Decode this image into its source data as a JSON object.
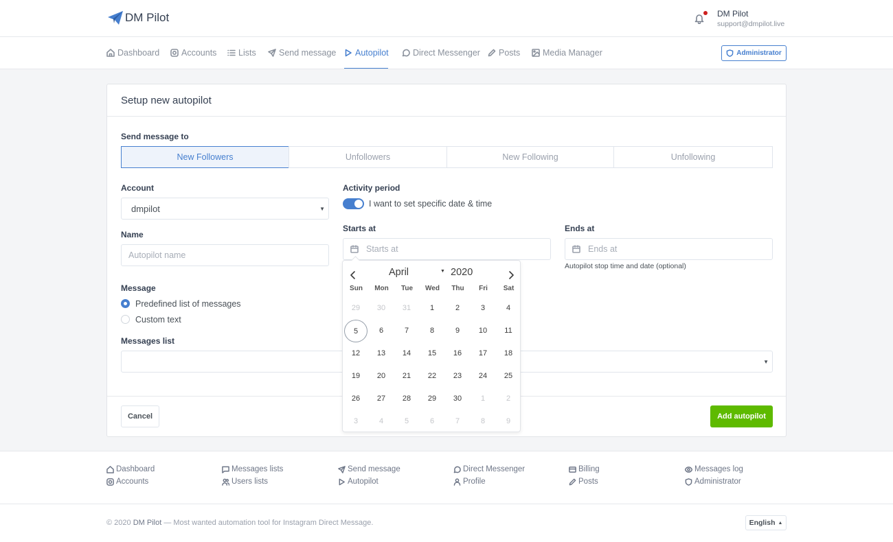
{
  "header": {
    "app_name": "DM Pilot",
    "user_name": "DM Pilot",
    "user_email": "support@dmpilot.live"
  },
  "nav": {
    "items": [
      {
        "label": "Dashboard",
        "icon": "home-icon"
      },
      {
        "label": "Accounts",
        "icon": "instagram-icon"
      },
      {
        "label": "Lists",
        "icon": "list-icon"
      },
      {
        "label": "Send message",
        "icon": "send-icon"
      },
      {
        "label": "Autopilot",
        "icon": "play-icon",
        "active": true
      },
      {
        "label": "Direct Messenger",
        "icon": "message-circle-icon"
      },
      {
        "label": "Posts",
        "icon": "pen-icon"
      },
      {
        "label": "Media Manager",
        "icon": "image-icon"
      }
    ],
    "admin_label": "Administrator"
  },
  "form": {
    "title": "Setup new autopilot",
    "send_to_label": "Send message to",
    "targets": [
      "New Followers",
      "Unfollowers",
      "New Following",
      "Unfollowing"
    ],
    "active_target": "New Followers",
    "account_label": "Account",
    "account_value": "dmpilot",
    "name_label": "Name",
    "name_placeholder": "Autopilot name",
    "activity_label": "Activity period",
    "toggle_label": "I want to set specific date & time",
    "toggle_on": true,
    "starts_label": "Starts at",
    "starts_placeholder": "Starts at",
    "ends_label": "Ends at",
    "ends_placeholder": "Ends at",
    "ends_help": "Autopilot stop time and date (optional)",
    "message_label": "Message",
    "message_options": [
      "Predefined list of messages",
      "Custom text"
    ],
    "message_selected": "Predefined list of messages",
    "messages_list_label": "Messages list",
    "cancel_label": "Cancel",
    "submit_label": "Add autopilot"
  },
  "datepicker": {
    "month": "April",
    "year": "2020",
    "weekdays": [
      "Sun",
      "Mon",
      "Tue",
      "Wed",
      "Thu",
      "Fri",
      "Sat"
    ],
    "weeks": [
      [
        [
          "29",
          true
        ],
        [
          "30",
          true
        ],
        [
          "31",
          true
        ],
        [
          "1",
          false
        ],
        [
          "2",
          false
        ],
        [
          "3",
          false
        ],
        [
          "4",
          false
        ]
      ],
      [
        [
          "5",
          false
        ],
        [
          "6",
          false
        ],
        [
          "7",
          false
        ],
        [
          "8",
          false
        ],
        [
          "9",
          false
        ],
        [
          "10",
          false
        ],
        [
          "11",
          false
        ]
      ],
      [
        [
          "12",
          false
        ],
        [
          "13",
          false
        ],
        [
          "14",
          false
        ],
        [
          "15",
          false
        ],
        [
          "16",
          false
        ],
        [
          "17",
          false
        ],
        [
          "18",
          false
        ]
      ],
      [
        [
          "19",
          false
        ],
        [
          "20",
          false
        ],
        [
          "21",
          false
        ],
        [
          "22",
          false
        ],
        [
          "23",
          false
        ],
        [
          "24",
          false
        ],
        [
          "25",
          false
        ]
      ],
      [
        [
          "26",
          false
        ],
        [
          "27",
          false
        ],
        [
          "28",
          false
        ],
        [
          "29",
          false
        ],
        [
          "30",
          false
        ],
        [
          "1",
          true
        ],
        [
          "2",
          true
        ]
      ],
      [
        [
          "3",
          true
        ],
        [
          "4",
          true
        ],
        [
          "5",
          true
        ],
        [
          "6",
          true
        ],
        [
          "7",
          true
        ],
        [
          "8",
          true
        ],
        [
          "9",
          true
        ]
      ]
    ],
    "today": "5"
  },
  "footer": {
    "columns": [
      [
        {
          "label": "Dashboard",
          "icon": "home-icon"
        },
        {
          "label": "Accounts",
          "icon": "instagram-icon"
        }
      ],
      [
        {
          "label": "Messages lists",
          "icon": "message-square-icon"
        },
        {
          "label": "Users lists",
          "icon": "users-icon"
        }
      ],
      [
        {
          "label": "Send message",
          "icon": "send-icon"
        },
        {
          "label": "Autopilot",
          "icon": "play-icon"
        }
      ],
      [
        {
          "label": "Direct Messenger",
          "icon": "message-circle-icon"
        },
        {
          "label": "Profile",
          "icon": "user-icon"
        }
      ],
      [
        {
          "label": "Billing",
          "icon": "credit-card-icon"
        },
        {
          "label": "Posts",
          "icon": "pen-icon"
        }
      ],
      [
        {
          "label": "Messages log",
          "icon": "eye-icon"
        },
        {
          "label": "Administrator",
          "icon": "shield-icon"
        }
      ]
    ],
    "copyright_prefix": "© 2020",
    "copyright_brand": "DM Pilot",
    "copyright_suffix": "— Most wanted automation tool for Instagram Direct Message.",
    "language": "English"
  },
  "colors": {
    "accent": "#467fcf",
    "success": "#5eba00",
    "notification": "#cd201f"
  }
}
